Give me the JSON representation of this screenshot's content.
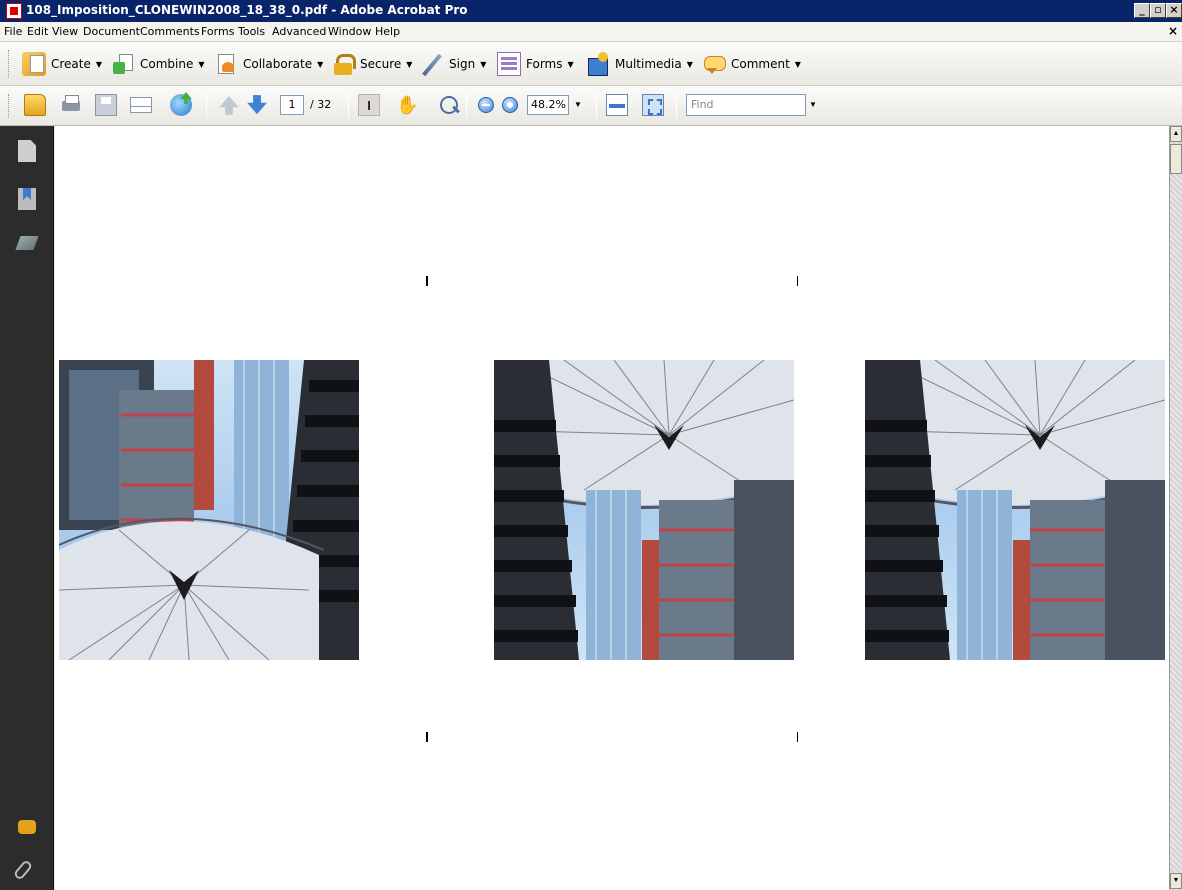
{
  "window": {
    "title": "108_Imposition_CLONEWIN2008_18_38_0.pdf - Adobe Acrobat Pro",
    "minimize": "_",
    "maximize": "▫",
    "close": "×"
  },
  "menu": {
    "items": [
      "File",
      "Edit",
      "View",
      "Document",
      "Comments",
      "Forms",
      "Tools",
      "Advanced",
      "Window",
      "Help"
    ],
    "doc_close": "×"
  },
  "tasks": {
    "items": [
      {
        "label": "Create",
        "icon": "create-pdf-icon"
      },
      {
        "label": "Combine",
        "icon": "combine-icon"
      },
      {
        "label": "Collaborate",
        "icon": "collaborate-icon"
      },
      {
        "label": "Secure",
        "icon": "lock-icon"
      },
      {
        "label": "Sign",
        "icon": "pen-icon"
      },
      {
        "label": "Forms",
        "icon": "forms-icon"
      },
      {
        "label": "Multimedia",
        "icon": "multimedia-icon"
      },
      {
        "label": "Comment",
        "icon": "comment-icon"
      }
    ],
    "dropdown_arrow": "▼"
  },
  "navigation": {
    "current_page": "1",
    "total_pages": "/ 32",
    "zoom": "48.2%",
    "find_placeholder": "Find",
    "select_tool": "I",
    "hand_tool": "✋",
    "dropdown_arrow": "▼"
  },
  "scrollbar": {
    "up": "▲",
    "down": "▼"
  },
  "colors": {
    "title_bar": "#0a246a",
    "nav_pane": "#2c2c2c",
    "toolbar": "#ece9d8",
    "page": "#ffffff"
  }
}
